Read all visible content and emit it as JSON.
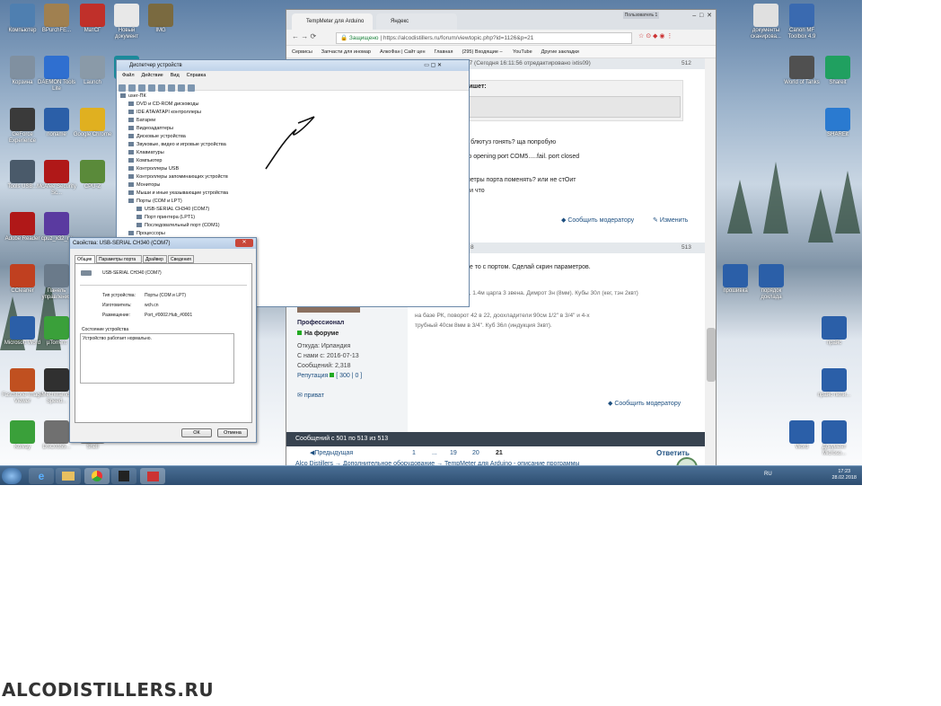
{
  "desktop": {
    "icons_left": [
      {
        "label": "Компьютер",
        "color": "#4f7fb0"
      },
      {
        "label": "BPurchFE...",
        "color": "#a08050"
      },
      {
        "label": "МатСГ",
        "color": "#c0302a"
      },
      {
        "label": "Новый документ",
        "color": "#e8e8e8"
      },
      {
        "label": "IMG",
        "color": "#7a6a40"
      },
      {
        "label": "Корзина",
        "color": "#8090a0"
      },
      {
        "label": "DAEMON Tools Lite",
        "color": "#2f6fd0"
      },
      {
        "label": "Launch",
        "color": "#8a9aa8"
      },
      {
        "label": "Arduino",
        "color": "#1b8a9a"
      },
      {
        "label": "GeForce Experience",
        "color": "#3a3a3a"
      },
      {
        "label": "noname",
        "color": "#2b5fa8"
      },
      {
        "label": "Google Chrome",
        "color": "#e0b020"
      },
      {
        "label": "Tools USB...",
        "color": "#4a5a6a"
      },
      {
        "label": "McAfee Security Sc...",
        "color": "#b01818"
      },
      {
        "label": "CPU-Z",
        "color": "#5a8a3a"
      },
      {
        "label": "Adobe Reader",
        "color": "#b01818"
      },
      {
        "label": "cpuz_x32_ru",
        "color": "#5a3aa0"
      },
      {
        "label": "CCleaner",
        "color": "#c04020"
      },
      {
        "label": "Панель управления",
        "color": "#6a7a8a"
      },
      {
        "label": "Microsoft Word",
        "color": "#2b5fa8"
      },
      {
        "label": "µTorrent",
        "color": "#3aa03a"
      },
      {
        "label": "FastStone Image Viewer",
        "color": "#c05020"
      },
      {
        "label": "Mechwarrior Speed...",
        "color": "#303030"
      },
      {
        "label": "Kolvay",
        "color": "#3aa03a"
      },
      {
        "label": "DSC0355...",
        "color": "#707070"
      },
      {
        "label": "Shell",
        "color": "#909090"
      }
    ],
    "icons_right": [
      {
        "label": "документы сканирова...",
        "color": "#e0e0e0"
      },
      {
        "label": "Canon MF Toolbox 4.9",
        "color": "#3a6ab0"
      },
      {
        "label": "World of Tanks",
        "color": "#505050"
      },
      {
        "label": "Shareit",
        "color": "#20a060"
      },
      {
        "label": "SHAREit",
        "color": "#2a7ad0"
      },
      {
        "label": "прошивка",
        "color": "#2b5fa8"
      },
      {
        "label": "порядок доклада",
        "color": "#2b5fa8"
      },
      {
        "label": "прайс",
        "color": "#2b5fa8"
      },
      {
        "label": "прайс пили...",
        "color": "#2b5fa8"
      },
      {
        "label": "Word",
        "color": "#2b5fa8"
      },
      {
        "label": "Документ Microso...",
        "color": "#2b5fa8"
      }
    ]
  },
  "browser": {
    "tabs": [
      "TempMeter для Arduino",
      "Яндекс"
    ],
    "title_user": "Пользователь 1",
    "secure_label": "Защищено",
    "url": "https://alcodistillers.ru/forum/viewtopic.php?id=1126&p=21",
    "bookmarks": [
      "Сервисы",
      "Запчасти для иномар",
      "АлкоФан | Сайт цен",
      "Главная",
      "(295) Входящие – ",
      "YouTube",
      "Другие закладки"
    ],
    "post1": {
      "header_user": "ixtis09",
      "header_edit": "07 (Сегодня 16:11:56 отредактировано ixtis09)",
      "number": "512",
      "quote_label": "ишет:",
      "lines": [
        "з блютуз гонять? ща попробую",
        "го opening port COM5.....fail. port closed",
        "метры порта поменять? или не стОит",
        "ли что"
      ],
      "report": "Сообщить модератору",
      "edit": "Изменить"
    },
    "post2": {
      "header_time": "8",
      "number": "513",
      "text1": "не то с портом. Сделай скрин параметров.",
      "text2": "а, 1.4м царга 3 звена. Димрот 3н (8мм). Кубы 30л (кег, тэн 2квт)",
      "text3": "на базе РК, поворот 42 в 22, доохладители 90см 1/2\" в 3/4\" и 4-х",
      "text4": "трубный 40см 8мм в 3/4\". Куб 36л (индукция 3квт).",
      "rank": "Профессионал",
      "status": "На форуме",
      "from": "Откуда: Ирландия",
      "since": "С нами с: 2016-07-13",
      "posts": "Сообщений: 2,318",
      "rep_label": "Репутация",
      "rep_value": "[ 300 | 0 ]",
      "private": "приват",
      "report": "Сообщить модератору"
    },
    "footer_bar": "Сообщений с 501 по 513 из 513",
    "pager": {
      "prev": "Предыдущая страница",
      "p1": "1",
      "dots": "...",
      "p19": "19",
      "p20": "20",
      "p21": "21",
      "next": "Ответить"
    },
    "crumbs": "Alco Distillers → Дополнительное оборудование → TempMeter для Arduino - описание программы"
  },
  "devmgr": {
    "title": "Диспетчер устройств",
    "menu": [
      "Файл",
      "Действие",
      "Вид",
      "Справка"
    ],
    "tree": [
      "user-ПК",
      "DVD и CD-ROM дисководы",
      "IDE ATA/ATAPI контроллеры",
      "Батареи",
      "Видеоадаптеры",
      "Дисковые устройства",
      "Звуковые, видео и игровые устройства",
      "Клавиатуры",
      "Компьютер",
      "Контроллеры USB",
      "Контроллеры запоминающих устройств",
      "Мониторы",
      "Мыши и иные указывающие устройства",
      "Порты (COM и LPT)",
      "USB-SERIAL CH340 (COM7)",
      "Порт принтера (LPT1)",
      "Последовательный порт (COM1)",
      "Процессоры"
    ]
  },
  "props": {
    "title": "Свойства: USB-SERIAL CH340 (COM7)",
    "tabs": [
      "Общие",
      "Параметры порта",
      "Драйвер",
      "Сведения"
    ],
    "device_name": "USB-SERIAL CH340 (COM7)",
    "type_label": "Тип устройства:",
    "type_value": "Порты (COM и LPT)",
    "mfr_label": "Изготовитель:",
    "mfr_value": "wch.cn",
    "loc_label": "Размещение:",
    "loc_value": "Port_#0002.Hub_#0001",
    "status_group": "Состояние устройства",
    "status_text": "Устройство работает нормально.",
    "ok": "ОК",
    "cancel": "Отмена"
  },
  "taskbar": {
    "lang": "RU",
    "time": "17:23",
    "date": "28.02.2018"
  },
  "watermark": "ALCODISTILLERS.RU"
}
